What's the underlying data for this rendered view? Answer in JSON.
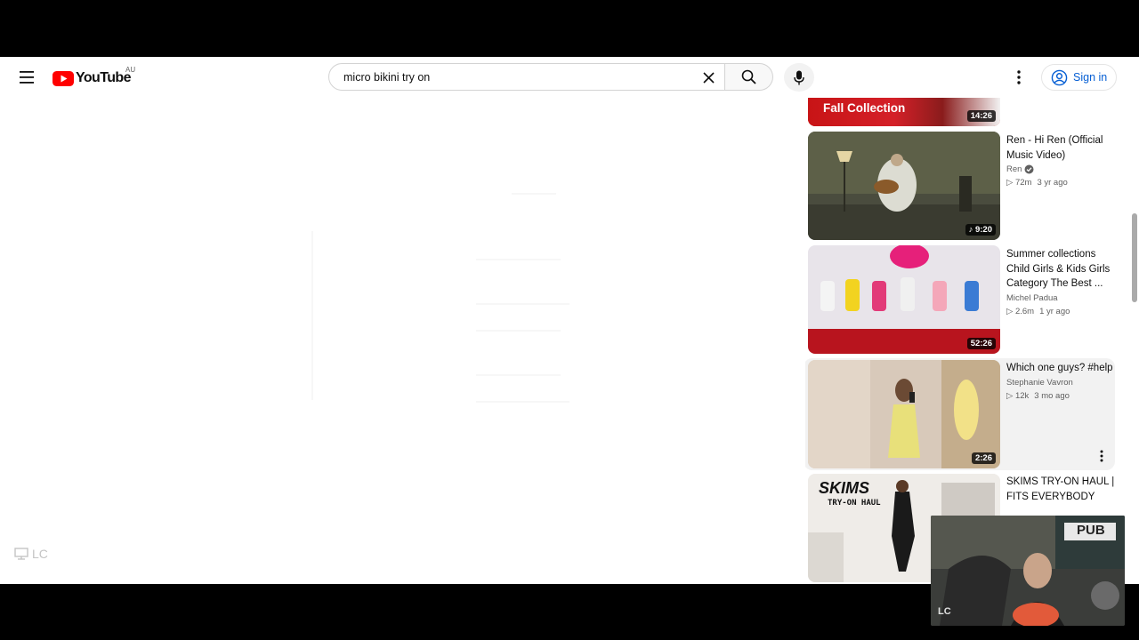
{
  "masthead": {
    "logo_text": "YouTube",
    "region": "AU",
    "search_value": "micro bikini try on",
    "sign_in_label": "Sign in"
  },
  "related": [
    {
      "title": "Fall Collection",
      "channel": "",
      "views": "",
      "age": "",
      "duration": "14:26",
      "partial": true
    },
    {
      "title": "Ren - Hi Ren (Official Music Video)",
      "channel": "Ren",
      "verified": true,
      "views": "72m",
      "age": "3 yr ago",
      "duration": "9:20",
      "music": true
    },
    {
      "title": "Summer collections Child Girls & Kids Girls Category The Best ...",
      "channel": "Michel Padua",
      "views": "2.6m",
      "age": "1 yr ago",
      "duration": "52:26"
    },
    {
      "title": "Which one guys? #help",
      "channel": "Stephanie Vavron",
      "views": "12k",
      "age": "3 mo ago",
      "duration": "2:26"
    },
    {
      "title": "SKIMS TRY-ON HAUL | FITS EVERYBODY COLLECTION ...",
      "channel": "",
      "views": "",
      "age": "",
      "duration": "",
      "thumb_text": "SKIMS",
      "thumb_subtext": "TRY-ON HAUL"
    }
  ],
  "watermark": "LC",
  "webcam": {
    "label": "LC",
    "sign": "PUB"
  },
  "colors": {
    "brand_red": "#ff0000",
    "link_blue": "#065fd4",
    "text_primary": "#0f0f0f",
    "text_secondary": "#606060"
  },
  "icons": [
    "menu-icon",
    "youtube-logo-icon",
    "clear-icon",
    "search-icon",
    "microphone-icon",
    "more-vert-icon",
    "account-circle-icon",
    "verified-icon",
    "play-icon",
    "music-note-icon"
  ]
}
